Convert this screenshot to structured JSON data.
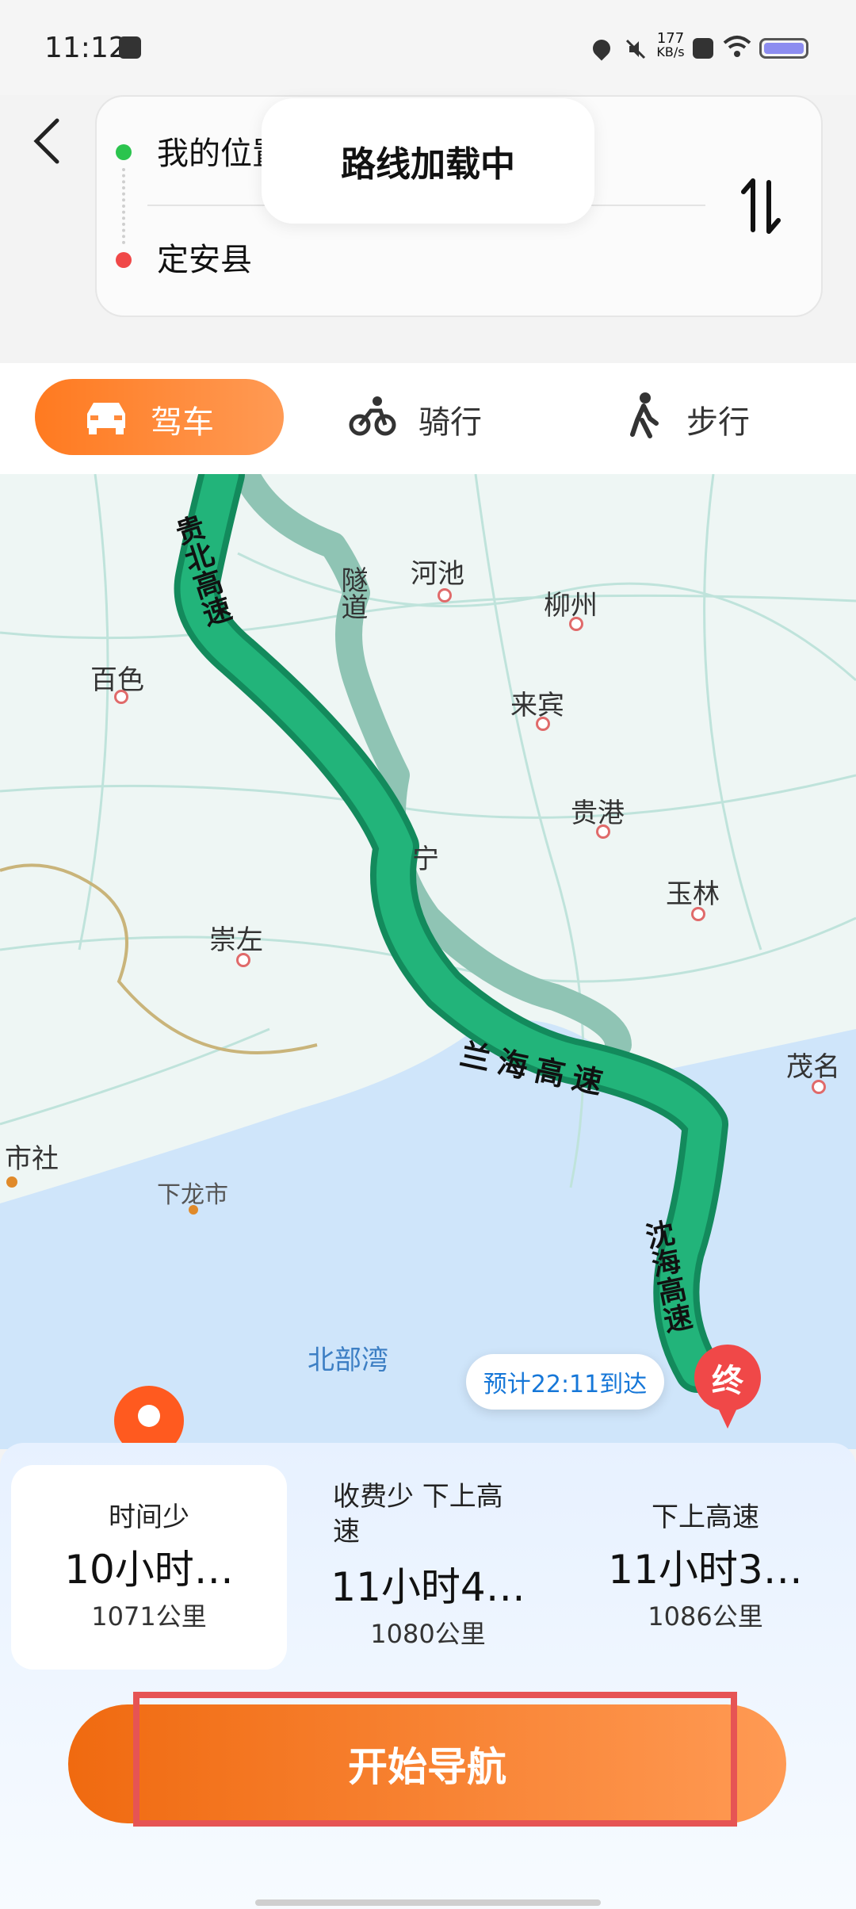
{
  "status_bar": {
    "time": "11:12",
    "network_speed_value": "177",
    "network_speed_unit": "KB/s"
  },
  "route": {
    "origin": "我的位置",
    "destination": "定安县"
  },
  "toast": {
    "text": "路线加载中"
  },
  "modes": [
    {
      "label": "驾车",
      "icon": "car-icon",
      "active": true
    },
    {
      "label": "骑行",
      "icon": "bike-icon",
      "active": false
    },
    {
      "label": "步行",
      "icon": "walk-icon",
      "active": false
    }
  ],
  "map": {
    "cities": [
      "河池",
      "柳州",
      "百色",
      "来宾",
      "贵港",
      "玉林",
      "崇左",
      "茂名",
      "市社",
      "下龙市",
      "北部湾",
      "宁"
    ],
    "roads": {
      "tunnel": "隧道",
      "road1": "贵北高速",
      "road2": "兰海高速",
      "road3": "沈海高速"
    },
    "eta": "预计22:11到达",
    "end_label": "终"
  },
  "options": [
    {
      "tag": "时间少",
      "time": "10小时…",
      "distance": "1071公里"
    },
    {
      "tag": "收费少 下上高速",
      "time": "11小时4…",
      "distance": "1080公里"
    },
    {
      "tag": "下上高速",
      "time": "11小时3…",
      "distance": "1086公里"
    }
  ],
  "start_button": "开始导航",
  "colors": {
    "accent": "#ff7a20",
    "route_primary": "#1aa770",
    "route_alt": "#9ccbbd"
  }
}
